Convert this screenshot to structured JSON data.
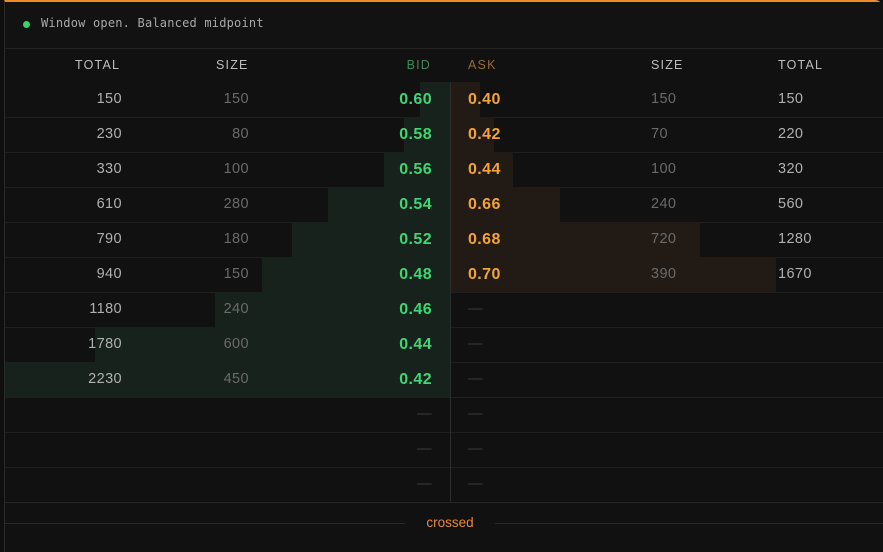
{
  "status": {
    "text": "Window open. Balanced midpoint",
    "dot_color": "#3ecf6a"
  },
  "headers": {
    "bid_total": "TOTAL",
    "bid_size": "SIZE",
    "bid": "BID",
    "ask": "ASK",
    "ask_size": "SIZE",
    "ask_total": "TOTAL"
  },
  "colors": {
    "bid": "#3fd674",
    "ask": "#f2a33a",
    "accent": "#f08a24"
  },
  "max_total": 2230,
  "bids": [
    {
      "total": "150",
      "size": "150",
      "price": "0.60"
    },
    {
      "total": "230",
      "size": "80",
      "price": "0.58"
    },
    {
      "total": "330",
      "size": "100",
      "price": "0.56"
    },
    {
      "total": "610",
      "size": "280",
      "price": "0.54"
    },
    {
      "total": "790",
      "size": "180",
      "price": "0.52"
    },
    {
      "total": "940",
      "size": "150",
      "price": "0.48"
    },
    {
      "total": "1180",
      "size": "240",
      "price": "0.46"
    },
    {
      "total": "1780",
      "size": "600",
      "price": "0.44"
    },
    {
      "total": "2230",
      "size": "450",
      "price": "0.42"
    }
  ],
  "asks": [
    {
      "total": "150",
      "size": "150",
      "price": "0.40"
    },
    {
      "total": "220",
      "size": "70",
      "price": "0.42"
    },
    {
      "total": "320",
      "size": "100",
      "price": "0.44"
    },
    {
      "total": "560",
      "size": "240",
      "price": "0.66"
    },
    {
      "total": "1280",
      "size": "720",
      "price": "0.68"
    },
    {
      "total": "1670",
      "size": "390",
      "price": "0.70"
    }
  ],
  "empty_placeholder": "—",
  "footer": {
    "label": "crossed"
  }
}
